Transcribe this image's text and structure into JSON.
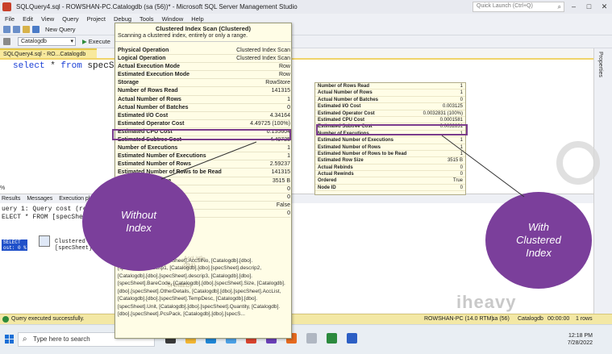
{
  "window": {
    "title": "SQLQuery4.sql - ROWSHAN-PC.Catalogdb (sa (56))* - Microsoft SQL Server Management Studio",
    "quick_launch_placeholder": "Quick Launch (Ctrl+Q)"
  },
  "menu": [
    "File",
    "Edit",
    "View",
    "Query",
    "Project",
    "Debug",
    "Tools",
    "Window",
    "Help"
  ],
  "toolbar": {
    "new_query": "New Query",
    "database": "Catalogdb",
    "execute": "Execute"
  },
  "document_tab": "SQLQuery4.sql - RO...Catalogdb (sa (56))*",
  "editor": {
    "keyword_select": "select",
    "star": " * ",
    "keyword_from": "from",
    "table": " specSheet",
    "zoom": "% "
  },
  "side_panel_label": "Properties",
  "result_tabs": [
    "Results",
    "Messages",
    "Execution plan"
  ],
  "results": {
    "line1": "uery 1: Query cost (re",
    "line2": "ELECT * FROM [specShe",
    "select_node": "SELECT\nost: 0 %",
    "scan_node": "Clustered\n[specSheet]"
  },
  "tooltip_left": {
    "title": "Clustered Index Scan (Clustered)",
    "subtitle": "Scanning a clustered index, entirely or only a range.",
    "rows": [
      {
        "k": "Physical Operation",
        "v": "Clustered Index Scan"
      },
      {
        "k": "Logical Operation",
        "v": "Clustered Index Scan"
      },
      {
        "k": "Actual Execution Mode",
        "v": "Row"
      },
      {
        "k": "Estimated Execution Mode",
        "v": "Row"
      },
      {
        "k": "Storage",
        "v": "RowStore"
      },
      {
        "k": "Number of Rows Read",
        "v": "141315"
      },
      {
        "k": "Actual Number of Rows",
        "v": "1"
      },
      {
        "k": "Actual Number of Batches",
        "v": "0"
      },
      {
        "k": "Estimated I/O Cost",
        "v": "4.34164"
      },
      {
        "k": "Estimated Operator Cost",
        "v": "4.49725 (100%)"
      },
      {
        "k": "Estimated CPU Cost",
        "v": "0.155604"
      },
      {
        "k": "Estimated Subtree Cost",
        "v": "4.49725"
      },
      {
        "k": "Number of Executions",
        "v": "1"
      },
      {
        "k": "Estimated Number of Executions",
        "v": "1"
      },
      {
        "k": "Estimated Number of Rows",
        "v": "2.59237"
      },
      {
        "k": "Estimated Number of Rows to be Read",
        "v": "141315"
      },
      {
        "k": "Estimated Row Size",
        "v": "3515 B"
      },
      {
        "k": "Actual Rebinds",
        "v": "0"
      },
      {
        "k": "Actual Rewinds",
        "v": "0"
      },
      {
        "k": "Ordered",
        "v": "False"
      },
      {
        "k": "Node ID",
        "v": "0"
      }
    ],
    "predicate_fragment": "AccList]=[@1]",
    "object_fragment": "0F848ED]",
    "output_label": "Output List",
    "output_list": "[Catalogdb].[dbo].[specSheet].AccSlNo, [Catalogdb].[dbo].[specSheet].descrip1, [Catalogdb].[dbo].[specSheet].descrip2, [Catalogdb].[dbo].[specSheet].descrip3, [Catalogdb].[dbo].[specSheet].BareCode, [Catalogdb].[dbo].[specSheet].Size, [Catalogdb].[dbo].[specSheet].OtherDetails, [Catalogdb].[dbo].[specSheet].AccList, [Catalogdb].[dbo].[specSheet].TempDesc, [Catalogdb].[dbo].[specSheet].Unit, [Catalogdb].[dbo].[specSheet].Quantity, [Catalogdb].[dbo].[specSheet].PcsPack, [Catalogdb].[dbo].[specS..."
  },
  "table_right": {
    "rows": [
      {
        "k": "Number of Rows Read",
        "v": "1"
      },
      {
        "k": "Actual Number of Rows",
        "v": "1"
      },
      {
        "k": "Actual Number of Batches",
        "v": "0"
      },
      {
        "k": "Estimated I/O Cost",
        "v": "0.003125"
      },
      {
        "k": "Estimated Operator Cost",
        "v": "0.0032831 (100%)"
      },
      {
        "k": "Estimated CPU Cost",
        "v": "0.0001581"
      },
      {
        "k": "Estimated Subtree Cost",
        "v": "0.0032831"
      },
      {
        "k": "Number of Executions",
        "v": "1"
      },
      {
        "k": "Estimated Number of Executions",
        "v": "1"
      },
      {
        "k": "Estimated Number of Rows",
        "v": "1"
      },
      {
        "k": "Estimated Number of Rows to be Read",
        "v": "1"
      },
      {
        "k": "Estimated Row Size",
        "v": "3515 B"
      },
      {
        "k": "Actual Rebinds",
        "v": "0"
      },
      {
        "k": "Actual Rewinds",
        "v": "0"
      },
      {
        "k": "Ordered",
        "v": "True"
      },
      {
        "k": "Node ID",
        "v": "0"
      }
    ]
  },
  "annotations": {
    "left": "Without\nIndex",
    "right": "With\nClustered\nIndex"
  },
  "watermark": "iheavy",
  "statusbar": {
    "message": "Query executed successfully.",
    "server": "ROWSHAN-PC (14.0 RTM)",
    "user": "sa (56)",
    "database": "Catalogdb",
    "elapsed": "00:00:00",
    "rows": "1 rows"
  },
  "taskbar": {
    "search_placeholder": "Type here to search",
    "time": "12:18 PM",
    "date": "7/28/2022"
  },
  "colors": {
    "accent_purple": "#7b3f9b",
    "tooltip_bg": "#fffde6",
    "status_bg": "#f3e8a5"
  }
}
